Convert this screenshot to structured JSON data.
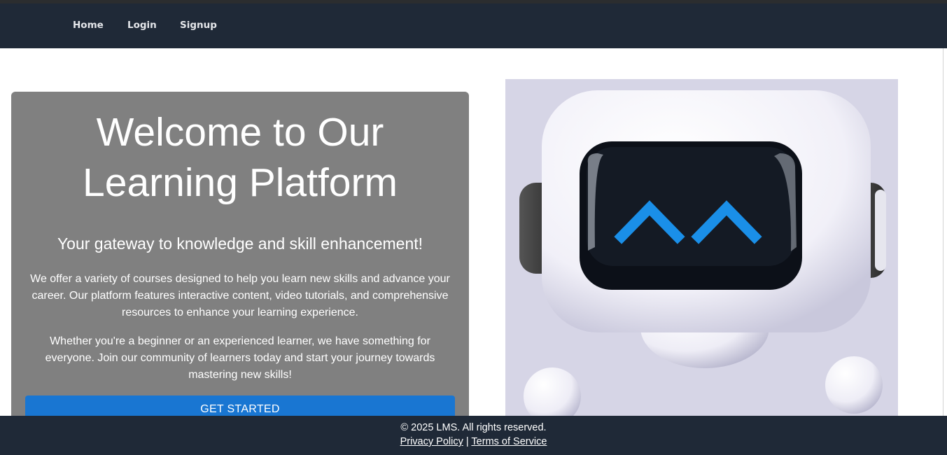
{
  "nav": {
    "home": "Home",
    "login": "Login",
    "signup": "Signup"
  },
  "hero": {
    "title_line1": "Welcome to Our",
    "title_line2": "Learning Platform",
    "subtitle": "Your gateway to knowledge and skill enhancement!",
    "paragraph1": "We offer a variety of courses designed to help you learn new skills and advance your career. Our platform features interactive content, video tutorials, and comprehensive resources to enhance your learning experience.",
    "paragraph2": "Whether you're a beginner or an experienced learner, we have something for everyone. Join our community of learners today and start your journey towards mastering new skills!",
    "cta_label": "GET STARTED"
  },
  "illustration": {
    "icon": "robot-mascot-icon",
    "background": "#d6d5e6"
  },
  "footer": {
    "copyright": "© 2025 LMS. All rights reserved.",
    "privacy": "Privacy Policy",
    "separator": "|",
    "terms": "Terms of Service"
  },
  "colors": {
    "navbar": "#1f2937",
    "card": "#808080",
    "accent": "#1976d2"
  }
}
